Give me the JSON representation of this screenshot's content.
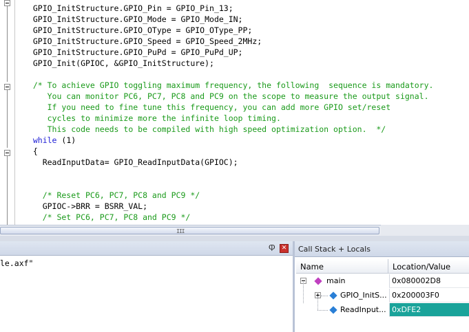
{
  "editor": {
    "lines": [
      [
        {
          "t": "  GPIO_InitStructure.GPIO_Pin = GPIO_Pin_13;",
          "c": "tx"
        }
      ],
      [
        {
          "t": "  GPIO_InitStructure.GPIO_Mode = GPIO_Mode_IN;",
          "c": "tx"
        }
      ],
      [
        {
          "t": "  GPIO_InitStructure.GPIO_OType = GPIO_OType_PP;",
          "c": "tx"
        }
      ],
      [
        {
          "t": "  GPIO_InitStructure.GPIO_Speed = GPIO_Speed_2MHz;",
          "c": "tx"
        }
      ],
      [
        {
          "t": "  GPIO_InitStructure.GPIO_PuPd = GPIO_PuPd_UP;",
          "c": "tx"
        }
      ],
      [
        {
          "t": "  GPIO_Init(GPIOC, &GPIO_InitStructure);",
          "c": "tx"
        }
      ],
      [
        {
          "t": "",
          "c": "tx"
        }
      ],
      [
        {
          "t": "  /* To achieve GPIO toggling maximum frequency, the following  sequence is mandatory.",
          "c": "cm"
        }
      ],
      [
        {
          "t": "     You can monitor PC6, PC7, PC8 and PC9 on the scope to measure the output signal.",
          "c": "cm"
        }
      ],
      [
        {
          "t": "     If you need to fine tune this frequency, you can add more GPIO set/reset",
          "c": "cm"
        }
      ],
      [
        {
          "t": "     cycles to minimize more the infinite loop timing.",
          "c": "cm"
        }
      ],
      [
        {
          "t": "     This code needs to be compiled with high speed optimization option.  */",
          "c": "cm"
        }
      ],
      [
        {
          "t": "  while",
          "c": "kw"
        },
        {
          "t": " (1)",
          "c": "tx"
        }
      ],
      [
        {
          "t": "  {",
          "c": "tx"
        }
      ],
      [
        {
          "t": "    ReadInputData= GPIO_ReadInputData(GPIOC);",
          "c": "tx"
        }
      ],
      [
        {
          "t": "",
          "c": "tx"
        }
      ],
      [
        {
          "t": "",
          "c": "tx"
        }
      ],
      [
        {
          "t": "    /* Reset PC6, PC7, PC8 and PC9 */",
          "c": "cm"
        }
      ],
      [
        {
          "t": "    GPIOC->BRR = BSRR_VAL;",
          "c": "tx"
        }
      ],
      [
        {
          "t": "    /* Set PC6, PC7, PC8 and PC9 */",
          "c": "cm"
        }
      ]
    ]
  },
  "scrollbar": {
    "grip": "III"
  },
  "bottom_left": {
    "text": "le.axf\"",
    "pin_icon": "pin-icon",
    "close_icon": "close-icon",
    "close_glyph": "✕",
    "pin_glyph": "Ⴔ"
  },
  "call_stack": {
    "title": "Call Stack + Locals",
    "columns": {
      "name": "Name",
      "location": "Location/Value"
    },
    "rows": [
      {
        "name": "main",
        "value": "0x080002D8",
        "icon": "function-icon",
        "color": "#c040c0",
        "expanded": true
      },
      {
        "name": "GPIO_InitS...",
        "value": "0x200003F0",
        "icon": "variable-icon",
        "color": "#2a7fd6",
        "expanded": false
      },
      {
        "name": "ReadInput...",
        "value": "0xDFE2",
        "icon": "variable-icon",
        "color": "#2a7fd6",
        "selected": true
      }
    ]
  },
  "colors": {
    "keyword": "#1f1fd6",
    "comment": "#1a9a1a",
    "selection": "#1aa39a"
  }
}
